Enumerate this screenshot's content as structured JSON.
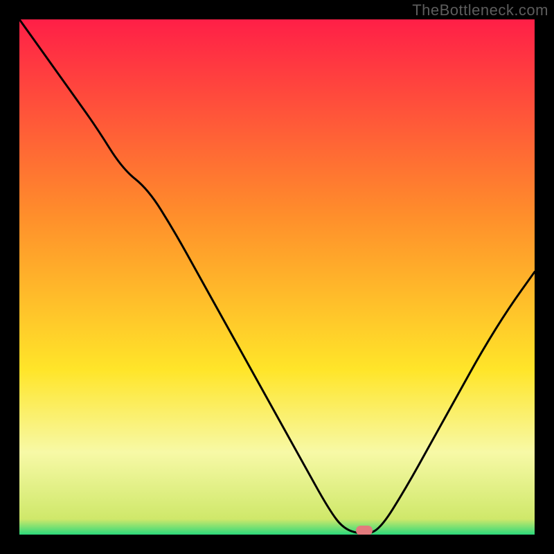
{
  "watermark": "TheBottleneck.com",
  "colors": {
    "red": "#ff1f47",
    "orange": "#ff8e2b",
    "yellow": "#ffe529",
    "pale": "#f7f9a6",
    "green": "#2bd97b",
    "bg": "#000000",
    "curve": "#000000",
    "marker": "#e37a7d"
  },
  "chart_data": {
    "type": "line",
    "title": "",
    "xlabel": "",
    "ylabel": "",
    "xlim": [
      0,
      100
    ],
    "ylim": [
      0,
      100
    ],
    "series": [
      {
        "name": "bottleneck-curve",
        "x": [
          0,
          5,
          10,
          15,
          20,
          25,
          30,
          35,
          40,
          45,
          50,
          55,
          60,
          63,
          67,
          70,
          75,
          80,
          85,
          90,
          95,
          100
        ],
        "values": [
          100,
          93,
          86,
          79,
          71,
          67,
          59,
          50,
          41,
          32,
          23,
          14,
          5,
          1,
          0,
          1,
          9,
          18,
          27,
          36,
          44,
          51
        ]
      }
    ],
    "marker": {
      "x": 67,
      "y": 0
    },
    "gradient_stops": [
      {
        "pct": 0,
        "color": "#ff1f47"
      },
      {
        "pct": 38,
        "color": "#ff8e2b"
      },
      {
        "pct": 68,
        "color": "#ffe529"
      },
      {
        "pct": 84,
        "color": "#f7f9a6"
      },
      {
        "pct": 97,
        "color": "#cfe86a"
      },
      {
        "pct": 100,
        "color": "#2bd97b"
      }
    ]
  }
}
